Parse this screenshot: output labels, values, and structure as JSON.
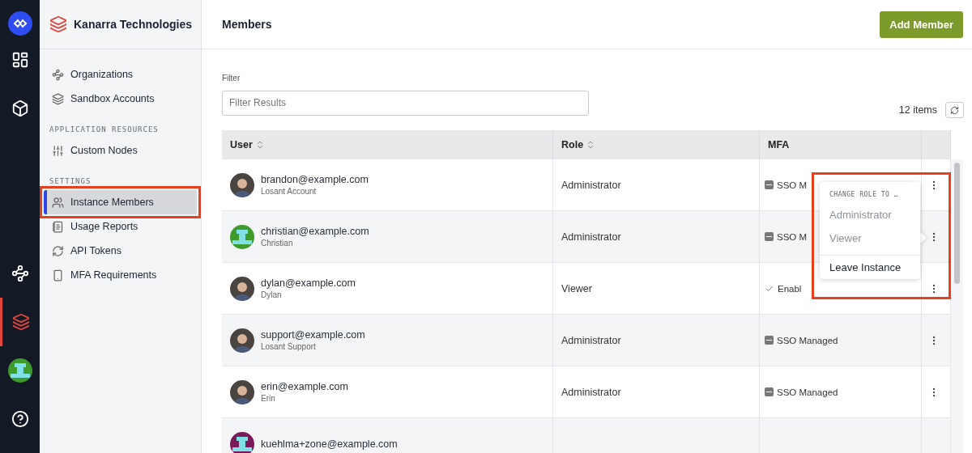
{
  "org": {
    "name": "Kanarra Technologies"
  },
  "sidebar": {
    "sections": [
      {
        "items": [
          {
            "label": "Organizations",
            "selected": false
          },
          {
            "label": "Sandbox Accounts",
            "selected": false
          }
        ]
      },
      {
        "heading": "APPLICATION RESOURCES",
        "items": [
          {
            "label": "Custom Nodes",
            "selected": false
          }
        ]
      },
      {
        "heading": "SETTINGS",
        "items": [
          {
            "label": "Instance Members",
            "selected": true,
            "highlighted": true
          },
          {
            "label": "Usage Reports",
            "selected": false
          },
          {
            "label": "API Tokens",
            "selected": false
          },
          {
            "label": "MFA Requirements",
            "selected": false
          }
        ]
      }
    ]
  },
  "page": {
    "title": "Members",
    "add_button": "Add Member"
  },
  "filter": {
    "label": "Filter",
    "placeholder": "Filter Results"
  },
  "item_count": "12 items",
  "table": {
    "columns": [
      "User",
      "Role",
      "MFA"
    ],
    "rows": [
      {
        "email": "brandon@example.com",
        "name": "Losant Account",
        "avatar": {
          "kind": "photo"
        },
        "role": "Administrator",
        "mfa": {
          "kind": "sso",
          "text": "SSO M"
        }
      },
      {
        "email": "christian@example.com",
        "name": "Christian",
        "avatar": {
          "kind": "identicon",
          "color": "#3f9a2c"
        },
        "role": "Administrator",
        "mfa": {
          "kind": "sso",
          "text": "SSO M"
        }
      },
      {
        "email": "dylan@example.com",
        "name": "Dylan",
        "avatar": {
          "kind": "photo"
        },
        "role": "Viewer",
        "mfa": {
          "kind": "enabled",
          "text": "Enabl"
        }
      },
      {
        "email": "support@example.com",
        "name": "Losant Support",
        "avatar": {
          "kind": "photo"
        },
        "role": "Administrator",
        "mfa": {
          "kind": "sso",
          "text": "SSO Managed"
        }
      },
      {
        "email": "erin@example.com",
        "name": "Erin",
        "avatar": {
          "kind": "photo"
        },
        "role": "Administrator",
        "mfa": {
          "kind": "sso",
          "text": "SSO Managed"
        }
      },
      {
        "email": "kuehlma+zone@example.com",
        "avatar": {
          "kind": "identicon",
          "color": "#7a1a5a"
        }
      }
    ]
  },
  "menu": {
    "heading": "CHANGE ROLE TO …",
    "roles": [
      {
        "label": "Administrator",
        "disabled": true
      },
      {
        "label": "Viewer",
        "disabled": true
      }
    ],
    "action": "Leave Instance"
  }
}
